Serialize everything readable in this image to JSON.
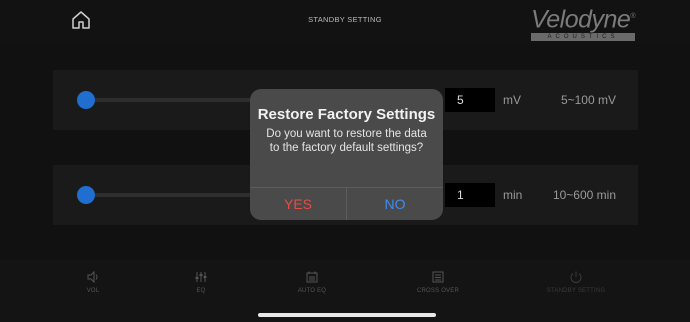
{
  "header": {
    "title": "STANDBY SETTING",
    "home_icon": "home-icon",
    "logo_word": "Velodyne",
    "logo_tm": "®",
    "logo_sub": "ACOUSTICS"
  },
  "rows": [
    {
      "value": "5",
      "unit": "mV",
      "range": "5~100 mV",
      "slider_fraction": 0.0
    },
    {
      "value": "1",
      "unit": "min",
      "range": "10~600 min",
      "slider_fraction": 0.0
    }
  ],
  "dialog": {
    "title": "Restore Factory Settings",
    "message": "Do you want to restore the data to the factory default settings?",
    "yes_label": "YES",
    "no_label": "NO",
    "yes_color": "#e84a45",
    "no_color": "#3f8cf0"
  },
  "bottom_nav": [
    {
      "label": "VOL",
      "icon": "speaker-icon"
    },
    {
      "label": "EQ",
      "icon": "equalizer-icon"
    },
    {
      "label": "AUTO EQ",
      "icon": "auto-eq-icon"
    },
    {
      "label": "CROSS OVER",
      "icon": "crossover-icon"
    },
    {
      "label": "STANDBY SETTING",
      "icon": "standby-icon"
    }
  ],
  "colors": {
    "slider_knob": "#1f6ed0",
    "background": "#111111"
  }
}
